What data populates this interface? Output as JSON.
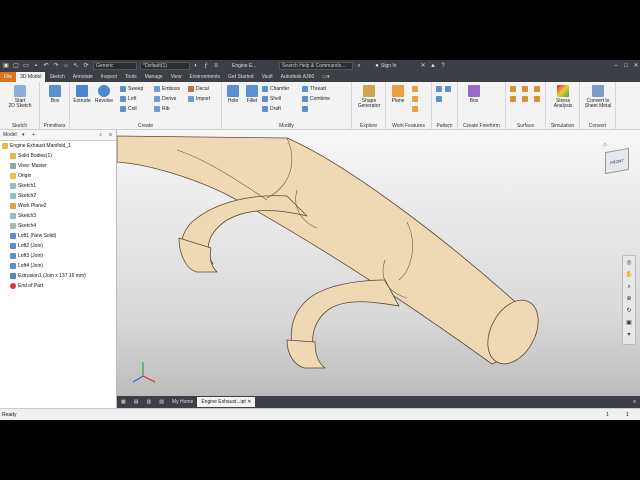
{
  "titlebar": {
    "material": "Generic",
    "appearance": "*Default(1)",
    "doc_title": "Engine E...",
    "search_placeholder": "Search Help & Commands...",
    "signin": "Sign In"
  },
  "tabs": [
    {
      "label": "File"
    },
    {
      "label": "3D Model"
    },
    {
      "label": "Sketch"
    },
    {
      "label": "Annotate"
    },
    {
      "label": "Inspect"
    },
    {
      "label": "Tools"
    },
    {
      "label": "Manage"
    },
    {
      "label": "View"
    },
    {
      "label": "Environments"
    },
    {
      "label": "Get Started"
    },
    {
      "label": "Vault"
    },
    {
      "label": "Autodesk A360"
    }
  ],
  "ribbon": {
    "sketch": {
      "start": "Start",
      "start2": "2D Sketch",
      "group": "Sketch"
    },
    "primitives": {
      "box": "Box",
      "group": "Primitives"
    },
    "create": {
      "extrude": "Extrude",
      "revolve": "Revolve",
      "sweep": "Sweep",
      "loft": "Loft",
      "coil": "Coil",
      "emboss": "Emboss",
      "derive": "Derive",
      "rib": "Rib",
      "decal": "Decal",
      "import": "Import",
      "group": "Create"
    },
    "modify": {
      "hole": "Hole",
      "fillet": "Fillet",
      "chamfer": "Chamfer",
      "shell": "Shell",
      "draft": "Draft",
      "thread": "Thread",
      "combine": "Combine",
      "group": "Modify"
    },
    "explore": {
      "shape": "Shape",
      "generator": "Generator",
      "group": "Explore"
    },
    "work": {
      "plane": "Plane",
      "group": "Work Features"
    },
    "pattern": {
      "group": "Pattern"
    },
    "freeform": {
      "box": "Box",
      "group": "Create Freeform"
    },
    "surface": {
      "group": "Surface"
    },
    "simulation": {
      "stress": "Stress",
      "analysis": "Analysis",
      "group": "Simulation"
    },
    "convert": {
      "convert": "Convert to",
      "sheet": "Sheet Metal",
      "group": "Convert"
    }
  },
  "browser": {
    "title": "Model",
    "nodes": [
      {
        "label": "Engine Exhaust Manifold_1"
      },
      {
        "label": "Solid Bodies(1)"
      },
      {
        "label": "View: Master"
      },
      {
        "label": "Origin"
      },
      {
        "label": "Sketch1"
      },
      {
        "label": "Sketch2"
      },
      {
        "label": "Work Plane2"
      },
      {
        "label": "Sketch3"
      },
      {
        "label": "Sketch4"
      },
      {
        "label": "Loft1 (New Solid)"
      },
      {
        "label": "Loft2 (Join)"
      },
      {
        "label": "Loft3 (Join)"
      },
      {
        "label": "Loft4 (Join)"
      },
      {
        "label": "Extrusion1 (Join x 137.16 mm)"
      },
      {
        "label": "End of Part"
      }
    ]
  },
  "viewcube": {
    "face": "FRONT"
  },
  "doctabs": [
    {
      "label": "My Home"
    },
    {
      "label": "Engine Exhaust...ipt"
    }
  ],
  "status": {
    "text": "Ready",
    "count1": "1",
    "count2": "1"
  },
  "colors": {
    "part_fill": "#efd9b5",
    "part_edge": "#5a4a36",
    "accent": "#d9731f"
  }
}
